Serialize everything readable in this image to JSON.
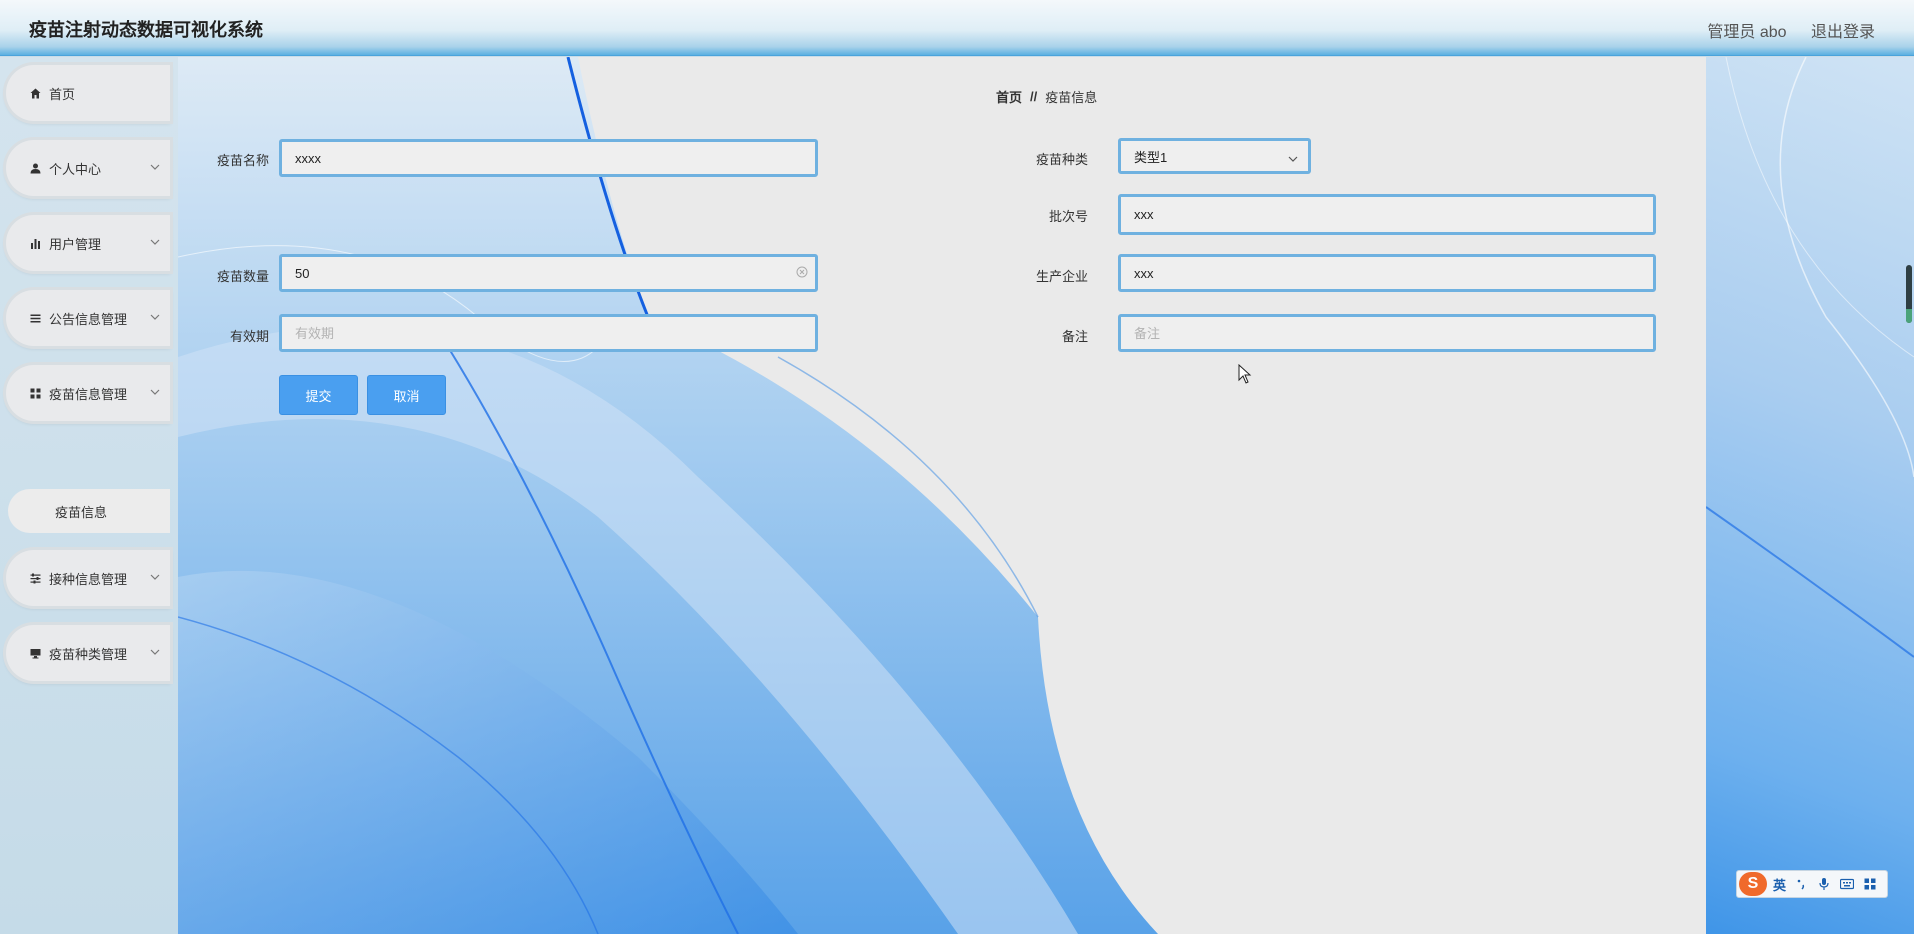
{
  "header": {
    "title": "疫苗注射动态数据可视化系统",
    "user_label": "管理员 abo",
    "logout_label": "退出登录"
  },
  "sidebar": {
    "items": [
      {
        "label": "首页",
        "icon": "home-icon"
      },
      {
        "label": "个人中心",
        "icon": "user-icon"
      },
      {
        "label": "用户管理",
        "icon": "bar-chart-icon"
      },
      {
        "label": "公告信息管理",
        "icon": "list-icon"
      },
      {
        "label": "疫苗信息管理",
        "icon": "grid-icon"
      },
      {
        "label": "接种信息管理",
        "icon": "sliders-icon"
      },
      {
        "label": "疫苗种类管理",
        "icon": "monitor-icon"
      }
    ],
    "submenu": {
      "label": "疫苗信息"
    }
  },
  "breadcrumb": {
    "home": "首页",
    "separator": "//",
    "current": "疫苗信息"
  },
  "form": {
    "name": {
      "label": "疫苗名称",
      "value": "xxxx"
    },
    "type": {
      "label": "疫苗种类",
      "value": "类型1"
    },
    "batch": {
      "label": "批次号",
      "value": "xxx"
    },
    "quantity": {
      "label": "疫苗数量",
      "value": "50"
    },
    "manufacturer": {
      "label": "生产企业",
      "value": "xxx"
    },
    "expiry": {
      "label": "有效期",
      "placeholder": "有效期"
    },
    "remark": {
      "label": "备注",
      "placeholder": "备注"
    },
    "submit_label": "提交",
    "cancel_label": "取消"
  },
  "ime": {
    "lang": "英",
    "logo": "S"
  },
  "colors": {
    "accent": "#4a9ff0",
    "field_border": "#6fb1e0",
    "header_bottom": "#4aa3db"
  }
}
